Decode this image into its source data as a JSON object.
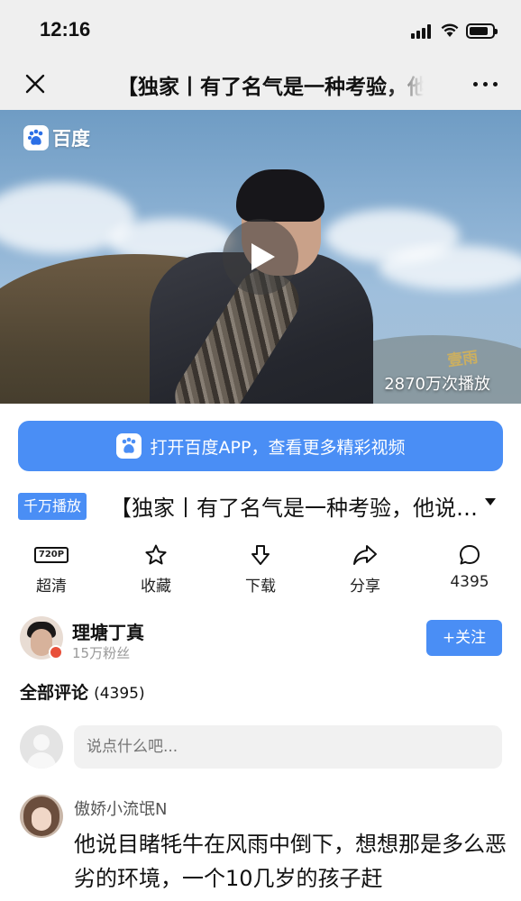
{
  "status_bar": {
    "time": "12:16"
  },
  "nav": {
    "title": "【独家丨有了名气是一种考验，他"
  },
  "video": {
    "brand": "百度",
    "view_count": "2870万次播放",
    "watermark": "壹雨"
  },
  "open_app": {
    "label": "打开百度APP，查看更多精彩视频"
  },
  "video_info": {
    "tag": "千万播放",
    "title": "【独家丨有了名气是一种考验，他说自己会一直保持"
  },
  "actions": [
    {
      "label": "超清",
      "icon": "hd-720p-icon"
    },
    {
      "label": "收藏",
      "icon": "star-icon"
    },
    {
      "label": "下载",
      "icon": "download-icon"
    },
    {
      "label": "分享",
      "icon": "share-icon"
    },
    {
      "label": "4395",
      "icon": "comment-icon"
    }
  ],
  "hd_badge": "720P",
  "author": {
    "name": "理塘丁真",
    "fans": "15万粉丝",
    "follow_label": "+关注"
  },
  "comments": {
    "header_label": "全部评论",
    "header_count": "(4395)",
    "input_placeholder": "说点什么吧...",
    "items": [
      {
        "user": "傲娇小流氓N",
        "text": "他说目睹牦牛在风雨中倒下，想想那是多么恶劣的环境，一个10几岁的孩子赶"
      }
    ]
  },
  "colors": {
    "accent": "#4a8ef5",
    "bar_bg": "#efefef"
  }
}
